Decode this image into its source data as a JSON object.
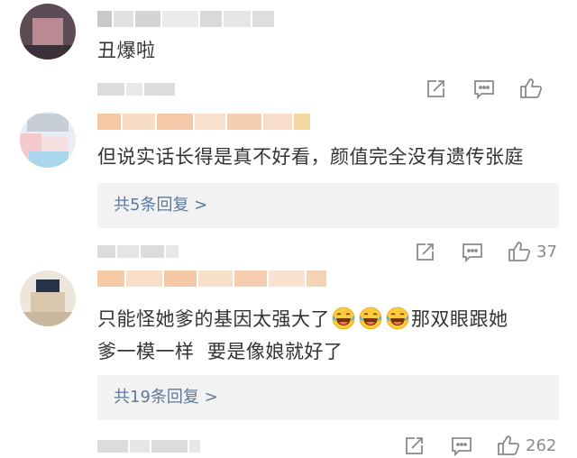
{
  "comments": [
    {
      "text": "丑爆啦",
      "like_count": ""
    },
    {
      "text": "但说实话长得是真不好看，颜值完全没有遗传张庭",
      "reply_summary": "共5条回复 >",
      "like_count": "37"
    },
    {
      "text_before_emoji": "只能怪她爹的基因太强大了",
      "emojis": [
        "laughing-tears-emoji",
        "laughing-tears-emoji",
        "laughing-tears-emoji"
      ],
      "text_after_emoji": "那双眼跟她",
      "text_line2": "爹一模一样  要是像娘就好了",
      "reply_summary": "共19条回复 >",
      "like_count": "262"
    }
  ],
  "icons": {
    "forward": "share-icon",
    "comment": "comment-icon",
    "like": "thumbs-up-icon"
  },
  "colors": {
    "text": "#333333",
    "link": "#5b7a9d",
    "action_gray": "#8a8a8a",
    "reply_bg": "#f2f2f2"
  }
}
